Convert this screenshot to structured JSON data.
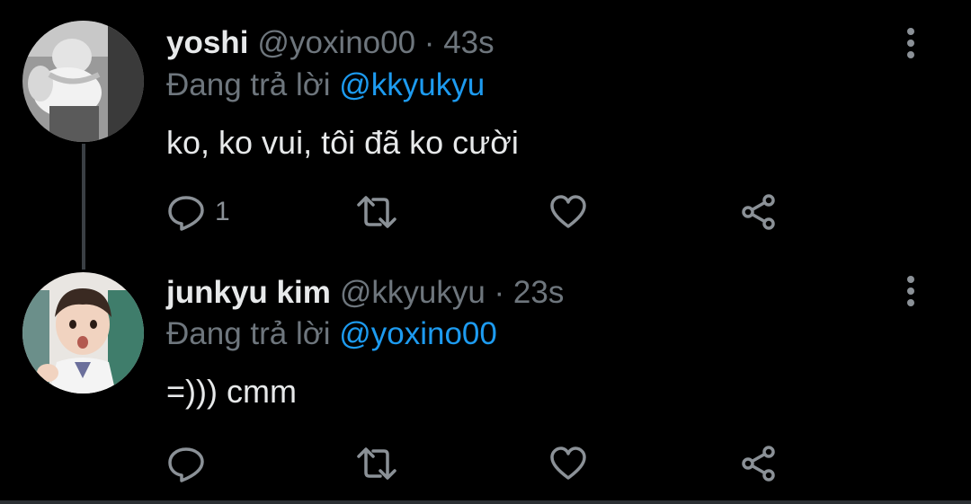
{
  "colors": {
    "background": "#000000",
    "primary_text": "#e7e9ea",
    "secondary_text": "#6e767d",
    "mention": "#1d9bf0",
    "icon": "#8b9197"
  },
  "tweets": [
    {
      "name": "yoshi",
      "handle": "@yoxino00",
      "time": "43s",
      "separator": "·",
      "replying_prefix": "Đang trả lời",
      "replying_to": "@kkyukyu",
      "text": "ko, ko vui, tôi đã ko cười",
      "reply_count": "1",
      "avatar_icon": "avatar-photo-grayscale"
    },
    {
      "name": "junkyu kim",
      "handle": "@kkyukyu",
      "time": "23s",
      "separator": "·",
      "replying_prefix": "Đang trả lời",
      "replying_to": "@yoxino00",
      "text": "=))) cmm",
      "reply_count": "",
      "avatar_icon": "avatar-photo-color"
    }
  ],
  "icons": {
    "reply": "reply-icon",
    "retweet": "retweet-icon",
    "like": "heart-icon",
    "share": "share-icon",
    "more": "more-vertical-icon"
  }
}
